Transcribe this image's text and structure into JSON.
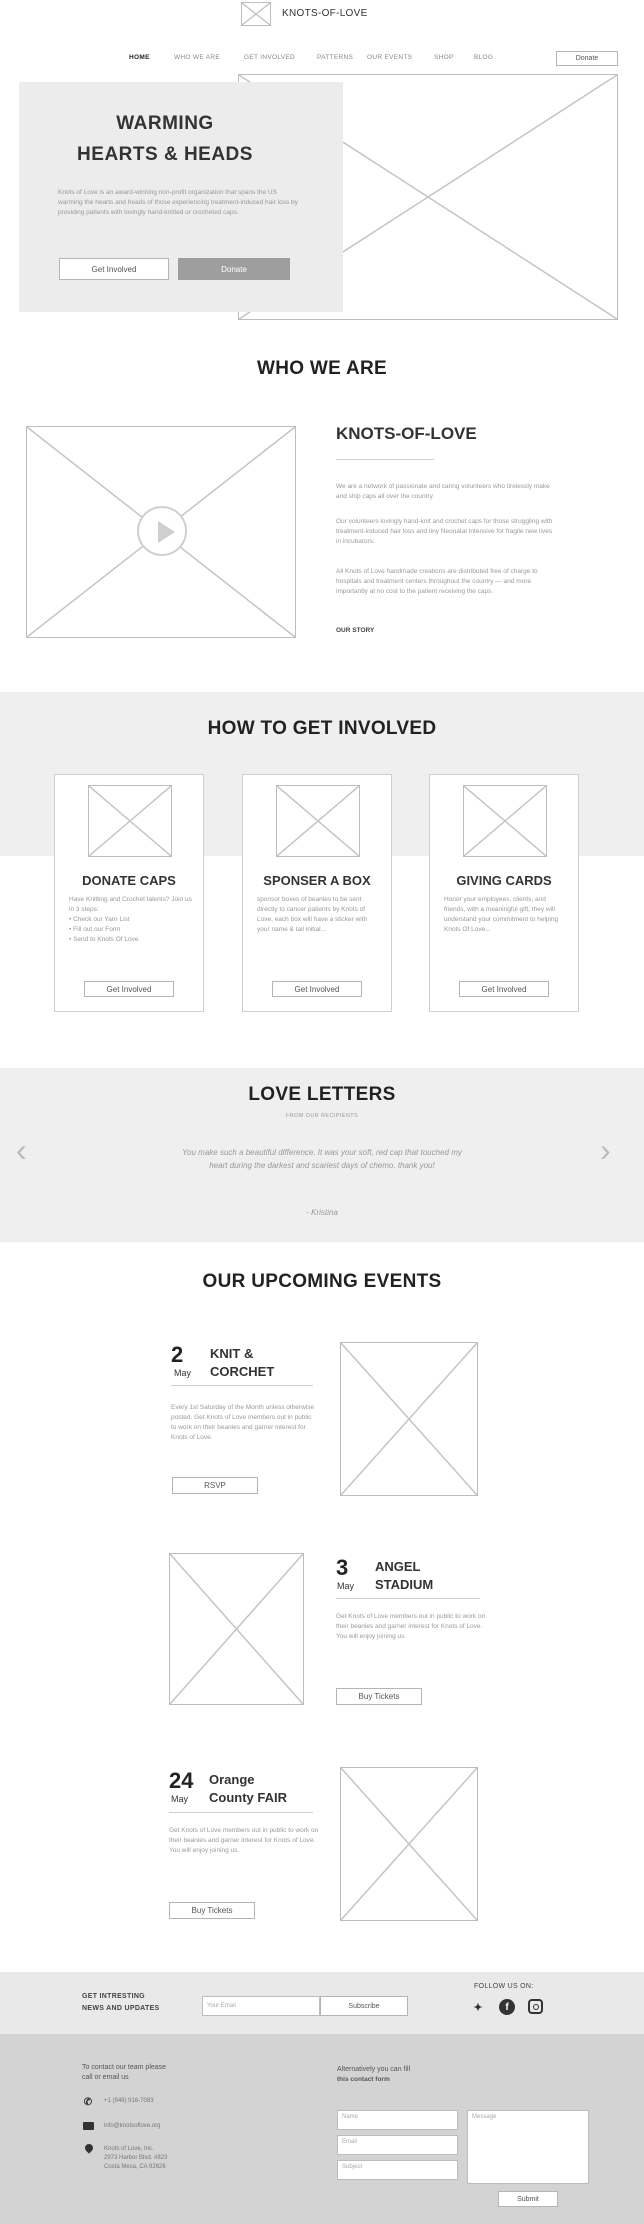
{
  "header": {
    "logo_text": "KNOTS-OF-LOVE",
    "nav": [
      {
        "label": "HOME"
      },
      {
        "label": "WHO WE ARE"
      },
      {
        "label": "GET INVOLVED"
      },
      {
        "label": "PATTERNS"
      },
      {
        "label": "OUR EVENTS"
      },
      {
        "label": "SHOP"
      },
      {
        "label": "BLOG"
      }
    ],
    "donate_label": "Donate"
  },
  "hero": {
    "title_line1": "WARMING",
    "title_line2": "HEARTS & HEADS",
    "text": "Knots of Love is an award-winning non-profit organization that spans the US warming the hearts and heads of those experiencing treatment-induced hair loss by providing patients with lovingly hand-knitted or crocheted caps.",
    "get_involved_label": "Get Involved",
    "donate_label": "Donate"
  },
  "who": {
    "heading": "WHO WE ARE",
    "subheading": "KNOTS-OF-LOVE",
    "p1": "We are a network of passionate and caring volunteers who tirelessly make and ship caps all over the country.",
    "p2": "Our volunteers lovingly hand-knit and crochet caps for those struggling with treatment-induced hair loss and tiny Neonatal Intensive for fragile new lives in incubators.",
    "p3": "All Knots of Love handmade creations are distributed free of charge to hospitals and treatment centers throughout the country — and more importantly at no cost to the patient receiving the caps.",
    "link": "OUR STORY"
  },
  "involved": {
    "heading": "HOW TO GET INVOLVED",
    "cards": [
      {
        "title": "DONATE CAPS",
        "text": "Have Knitting and Crochet talents? Join us in 3 steps:",
        "bullets": [
          "Check our Yarn List",
          "Fill out our Form",
          "Send to Knots Of Love"
        ],
        "button": "Get Involved"
      },
      {
        "title": "SPONSER A BOX",
        "text": "sponsor boxes of beanies to be sent directly to cancer patients by Knots of Love, each box will have a sticker with your name & tail initial...",
        "bullets": [],
        "button": "Get Involved"
      },
      {
        "title": "GIVING CARDS",
        "text": "Honor your employees, clients, and friends, with a meaningful gift, they will understand your commitment to helping Knots Of Love...",
        "bullets": [],
        "button": "Get Involved"
      }
    ]
  },
  "letters": {
    "heading": "LOVE LETTERS",
    "subheading": "FROM OUR RECIPIENTS",
    "quote": "You make such a beautiful difference. It was your soft, red cap that touched my heart during the darkest and scariest days of chemo. thank you!",
    "author": "- Kristina",
    "prev": "‹",
    "next": "›"
  },
  "events": {
    "heading": "OUR UPCOMING EVENTS",
    "items": [
      {
        "day": "2",
        "month": "May",
        "title_line1": "KNIT &",
        "title_line2": "CORCHET",
        "text": "Every 1st Saturday of the Month unless otherwise posted. Get Knots of Love members out in public to work on their beanies and garner interest for Knots of Love.",
        "button": "RSVP"
      },
      {
        "day": "3",
        "month": "May",
        "title_line1": "ANGEL",
        "title_line2": "STADIUM",
        "text": "Get Knots of Love members out in public to work on their beanies and garner interest for Knots of Love. You will enjoy joining us.",
        "button": "Buy Tickets"
      },
      {
        "day": "24",
        "month": "May",
        "title_line1": "Orange",
        "title_line2": "County FAIR",
        "text": "Get Knots of Love members out in public to work on their beanies and garner interest for Knots of Love. You will enjoy joining us.",
        "button": "Buy Tickets"
      }
    ]
  },
  "newsletter": {
    "label_line1": "GET INTRESTING",
    "label_line2": "NEWS AND UPDATES",
    "email_placeholder": "Your Email",
    "subscribe": "Subscribe",
    "follow": "FOLLOW US ON:",
    "social": [
      {
        "icon": "twitter-icon",
        "glyph": "🐦"
      },
      {
        "icon": "facebook-icon",
        "glyph": "f"
      },
      {
        "icon": "instagram-icon",
        "glyph": "◎"
      }
    ]
  },
  "contact": {
    "intro_line1": "To contact our team please",
    "intro_line2": "call or email us",
    "phone": "+1 (949) 916-7083",
    "email": "info@knotsoflove.org",
    "address_line1": "Knots of Love, Inc.",
    "address_line2": "2973 Harbor Blvd. #823",
    "address_line3": "Costa Mesa, CA 92626",
    "alt_line1": "Alternatively you can fill",
    "alt_line2": "this contact form",
    "name_placeholder": "Name",
    "email_placeholder": "Email",
    "subject_placeholder": "Subject",
    "message_placeholder": "Message",
    "submit": "Submit"
  }
}
